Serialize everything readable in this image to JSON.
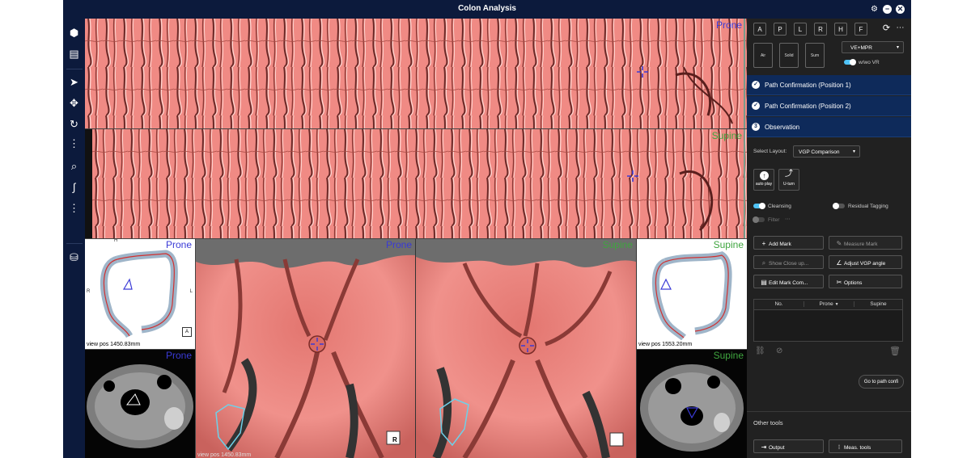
{
  "window": {
    "title": "Colon Analysis"
  },
  "viewer": {
    "top_strip_label": "Prone",
    "bottom_strip_label": "Supine",
    "vr_left_label": "Prone",
    "vr_left_pos": "view pos 1450.83mm",
    "ct_left_label": "Prone",
    "endo_left_label": "Prone",
    "endo_left_pos": "view pos 1450.83mm",
    "endo_right_label": "Supine",
    "vr_right_label": "Supine",
    "vr_right_pos": "view pos 1553.20mm",
    "ct_right_label": "Supine",
    "orient": {
      "H": "H",
      "R": "R",
      "L": "L",
      "F": "F",
      "P": "P",
      "A": "A"
    },
    "cube_label": "R"
  },
  "side": {
    "view_buttons": [
      "A",
      "P",
      "L",
      "R",
      "H",
      "F"
    ],
    "mode_buttons": [
      "Air",
      "Solid",
      "Sum"
    ],
    "render_select": "VE+MPR",
    "vr_toggle_label": "w/wo VR",
    "steps": [
      {
        "icon": "✓",
        "label": "Path Confirmation (Position 1)"
      },
      {
        "icon": "✓",
        "label": "Path Confirmation (Position 2)"
      },
      {
        "icon": "3",
        "label": "Observation"
      }
    ],
    "layout_label": "Select Layout:",
    "layout_value": "VGP Comparison",
    "auto_play": "auto play",
    "u_turn": "U-turn",
    "cleansing": "Cleansing",
    "residual_tagging": "Residual Tagging",
    "filter": "Filter",
    "add_mark": "Add Mark",
    "measure_mark": "Measure Mark",
    "show_close_up": "Show Close up...",
    "adjust_vgp": "Adjust VGP angle",
    "edit_mark_comment": "Edit Mark Com...",
    "options": "Options",
    "table_headers": [
      "No.",
      "Prone",
      "Supine"
    ],
    "go_to_path": "Go to path confi",
    "other_tools": "Other tools",
    "output": "Output",
    "meas_tools": "Meas. tools"
  },
  "colors": {
    "accent": "#4fc3f7",
    "navy": "#0c1a3c",
    "tissue": "#f08a84",
    "prone": "#3a3ad6",
    "supine": "#3fa53f"
  }
}
